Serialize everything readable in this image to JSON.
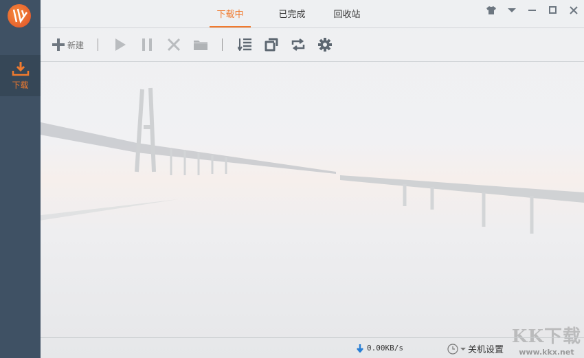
{
  "sidebar": {
    "items": [
      {
        "label": "下载",
        "icon": "download-icon"
      }
    ]
  },
  "tabs": [
    {
      "label": "下载中",
      "active": true
    },
    {
      "label": "已完成"
    },
    {
      "label": "回收站"
    }
  ],
  "toolbar": {
    "new_label": "新建"
  },
  "status": {
    "speed": "0.00KB/s",
    "shutdown_label": "关机设置"
  },
  "watermark": {
    "title": "KK下载",
    "url": "www.kkx.net"
  },
  "colors": {
    "accent": "#f07a2e",
    "sidebar": "#3f5164"
  }
}
